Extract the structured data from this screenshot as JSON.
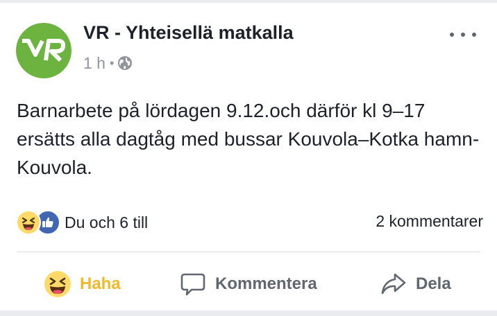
{
  "post": {
    "page_name": "VR - Yhteisellä matkalla",
    "avatar_text": "VR",
    "time": "1 h",
    "dot": "•",
    "privacy_icon": "globe-icon",
    "text": "Barnarbete på lördagen 9.12.och därför kl 9–17 ersätts alla dagtåg med bussar Kouvola–Kotka hamn-Kouvola."
  },
  "reactions": {
    "icons": [
      "haha-icon",
      "like-icon"
    ],
    "summary": "Du och 6 till",
    "comments": "2 kommentarer"
  },
  "actions": {
    "haha_label": "Haha",
    "comment_label": "Kommentera",
    "share_label": "Dela"
  },
  "colors": {
    "brand_green": "#6db33f",
    "haha_yellow": "#f0b92a",
    "like_blue": "#4267b2",
    "text": "#1d2129",
    "muted": "#606770"
  }
}
